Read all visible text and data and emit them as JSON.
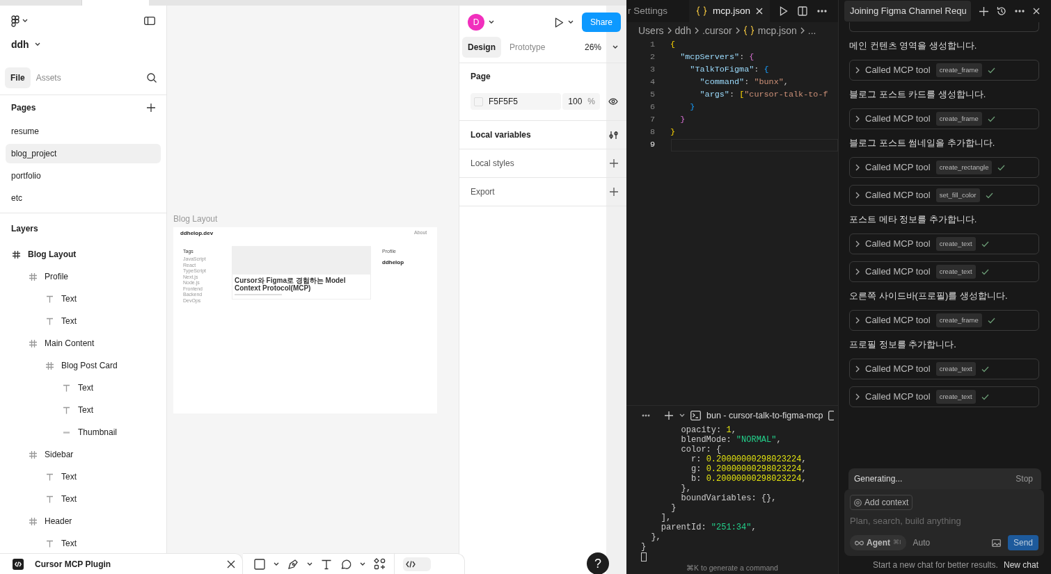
{
  "figma": {
    "file_name": "ddh",
    "left_tabs": [
      {
        "label": "File",
        "selected": true
      },
      {
        "label": "Assets",
        "selected": false
      }
    ],
    "pages_title": "Pages",
    "pages": [
      {
        "label": "resume",
        "selected": false
      },
      {
        "label": "blog_project",
        "selected": true
      },
      {
        "label": "portfolio",
        "selected": false
      },
      {
        "label": "etc",
        "selected": false
      }
    ],
    "layers_title": "Layers",
    "layers": [
      {
        "label": "Blog Layout",
        "kind": "frame",
        "children": [
          {
            "label": "Profile",
            "kind": "frame",
            "children": [
              {
                "label": "Text",
                "kind": "text"
              },
              {
                "label": "Text",
                "kind": "text"
              }
            ]
          },
          {
            "label": "Main Content",
            "kind": "frame",
            "children": [
              {
                "label": "Blog Post Card",
                "kind": "frame",
                "children": [
                  {
                    "label": "Text",
                    "kind": "text"
                  },
                  {
                    "label": "Text",
                    "kind": "text"
                  },
                  {
                    "label": "Thumbnail",
                    "kind": "rectangle"
                  }
                ]
              }
            ]
          },
          {
            "label": "Sidebar",
            "kind": "frame",
            "children": [
              {
                "label": "Text",
                "kind": "text"
              },
              {
                "label": "Text",
                "kind": "text"
              }
            ]
          },
          {
            "label": "Header",
            "kind": "frame",
            "children": [
              {
                "label": "Text",
                "kind": "text"
              }
            ]
          }
        ]
      }
    ],
    "canvas": {
      "frame_label": "Blog Layout",
      "artboard": {
        "site_title": "ddhelop.dev",
        "nav_link": "About",
        "tags_title": "Tags",
        "tags": [
          "JavaScript",
          "React",
          "TypeScript",
          "Next.js",
          "Node.js",
          "Frontend",
          "Backend",
          "DevOps"
        ],
        "post_title": "Cursor와 Figma로 경험하는 Model Context Protocol(MCP)",
        "profile_title": "Profile",
        "profile_name": "ddhelop"
      }
    },
    "plugin_name": "Cursor MCP Plugin",
    "dev_mode_on": false,
    "help": "?",
    "avatar": "D",
    "share": "Share",
    "right_tabs": [
      {
        "label": "Design",
        "selected": true
      },
      {
        "label": "Prototype",
        "selected": false
      }
    ],
    "zoom": "26%",
    "page_section": {
      "title": "Page",
      "color": "F5F5F5",
      "opacity": "100",
      "unit": "%"
    },
    "sections": [
      {
        "title": "Local variables",
        "kind": "variables"
      },
      {
        "title": "Local styles",
        "kind": "add"
      },
      {
        "title": "Export",
        "kind": "add"
      }
    ]
  },
  "editor": {
    "tabs": [
      {
        "label": "r Settings",
        "selected": false
      },
      {
        "label": "mcp.json",
        "selected": true
      }
    ],
    "breadcrumb": [
      "Users",
      "ddh",
      ".cursor",
      "mcp.json",
      "..."
    ],
    "lines": [
      {
        "number": "1",
        "current": false,
        "tokens": [
          {
            "text": "{",
            "kind": "brace-yellow"
          }
        ]
      },
      {
        "number": "2",
        "current": false,
        "tokens": [
          {
            "text": "  \"mcpServers\"",
            "kind": "key"
          },
          {
            "text": ": ",
            "kind": "punct"
          },
          {
            "text": "{",
            "kind": "brace-pink"
          }
        ]
      },
      {
        "number": "3",
        "current": false,
        "tokens": [
          {
            "text": "    \"TalkToFigma\"",
            "kind": "key"
          },
          {
            "text": ": ",
            "kind": "punct"
          },
          {
            "text": "{",
            "kind": "brace-blue"
          }
        ]
      },
      {
        "number": "4",
        "current": false,
        "tokens": [
          {
            "text": "      \"command\"",
            "kind": "key"
          },
          {
            "text": ": ",
            "kind": "punct"
          },
          {
            "text": "\"bunx\"",
            "kind": "string"
          },
          {
            "text": ",",
            "kind": "punct"
          }
        ]
      },
      {
        "number": "5",
        "current": false,
        "tokens": [
          {
            "text": "      \"args\"",
            "kind": "key"
          },
          {
            "text": ": ",
            "kind": "punct"
          },
          {
            "text": "[",
            "kind": "brace-yellow"
          },
          {
            "text": "\"cursor-talk-to-f",
            "kind": "string"
          }
        ]
      },
      {
        "number": "6",
        "current": false,
        "tokens": [
          {
            "text": "    }",
            "kind": "brace-blue"
          }
        ]
      },
      {
        "number": "7",
        "current": false,
        "tokens": [
          {
            "text": "  }",
            "kind": "brace-pink"
          }
        ]
      },
      {
        "number": "8",
        "current": false,
        "tokens": [
          {
            "text": "}",
            "kind": "brace-yellow"
          }
        ]
      },
      {
        "number": "9",
        "current": true
      }
    ],
    "terminal": {
      "title": "bun - cursor-talk-to-figma-mcp",
      "lines": [
        [
          {
            "text": "        opacity: ",
            "kind": "punct"
          },
          {
            "text": "1",
            "kind": "number"
          },
          {
            "text": ",",
            "kind": "punct"
          }
        ],
        [
          {
            "text": "        blendMode: ",
            "kind": "punct"
          },
          {
            "text": "\"NORMAL\"",
            "kind": "string"
          },
          {
            "text": ",",
            "kind": "punct"
          }
        ],
        [
          {
            "text": "        color: {",
            "kind": "punct"
          }
        ],
        [
          {
            "text": "          r: ",
            "kind": "punct"
          },
          {
            "text": "0.20000000298023224",
            "kind": "number"
          },
          {
            "text": ",",
            "kind": "punct"
          }
        ],
        [
          {
            "text": "          g: ",
            "kind": "punct"
          },
          {
            "text": "0.20000000298023224",
            "kind": "number"
          },
          {
            "text": ",",
            "kind": "punct"
          }
        ],
        [
          {
            "text": "          b: ",
            "kind": "punct"
          },
          {
            "text": "0.20000000298023224",
            "kind": "number"
          },
          {
            "text": ",",
            "kind": "punct"
          }
        ],
        [
          {
            "text": "        },",
            "kind": "punct"
          }
        ],
        [
          {
            "text": "        boundVariables: {},",
            "kind": "punct"
          }
        ],
        [
          {
            "text": "      }",
            "kind": "punct"
          }
        ],
        [
          {
            "text": "    ],",
            "kind": "punct"
          }
        ],
        [
          {
            "text": "    parentId: ",
            "kind": "punct"
          },
          {
            "text": "\"251:34\"",
            "kind": "string"
          },
          {
            "text": ",",
            "kind": "punct"
          }
        ],
        [
          {
            "text": "  },",
            "kind": "punct"
          }
        ],
        [
          {
            "text": "}",
            "kind": "punct"
          }
        ]
      ],
      "hint": "⌘K to generate a command"
    }
  },
  "chat": {
    "title": "Joining Figma Channel Requ",
    "entries": [
      {
        "kind": "tool_cut"
      },
      {
        "kind": "message",
        "text": "메인 컨텐츠 영역을 생성합니다."
      },
      {
        "kind": "tool",
        "label": "Called MCP tool",
        "tool": "create_frame",
        "done": true
      },
      {
        "kind": "message",
        "text": "블로그 포스트 카드를 생성합니다."
      },
      {
        "kind": "tool",
        "label": "Called MCP tool",
        "tool": "create_frame",
        "done": true
      },
      {
        "kind": "message",
        "text": "블로그 포스트 썸네일을 추가합니다."
      },
      {
        "kind": "tool",
        "label": "Called MCP tool",
        "tool": "create_rectangle",
        "done": true
      },
      {
        "kind": "tool",
        "label": "Called MCP tool",
        "tool": "set_fill_color",
        "done": true
      },
      {
        "kind": "message",
        "text": "포스트 메타 정보를 추가합니다."
      },
      {
        "kind": "tool",
        "label": "Called MCP tool",
        "tool": "create_text",
        "done": true
      },
      {
        "kind": "tool",
        "label": "Called MCP tool",
        "tool": "create_text",
        "done": true
      },
      {
        "kind": "message",
        "text": "오른쪽 사이드바(프로필)를 생성합니다."
      },
      {
        "kind": "tool",
        "label": "Called MCP tool",
        "tool": "create_frame",
        "done": true
      },
      {
        "kind": "message",
        "text": "프로필 정보를 추가합니다."
      },
      {
        "kind": "tool",
        "label": "Called MCP tool",
        "tool": "create_text",
        "done": true
      },
      {
        "kind": "tool",
        "label": "Called MCP tool",
        "tool": "create_text",
        "done": true
      }
    ],
    "status": "Generating...",
    "stop": "Stop",
    "add_context": "Add context",
    "placeholder": "Plan, search, build anything",
    "mode": "Agent",
    "mode_shortcut": "⌘I",
    "model": "Auto",
    "send": "Send",
    "footer_note": "Start a new chat for better results.",
    "new_chat": "New chat"
  }
}
